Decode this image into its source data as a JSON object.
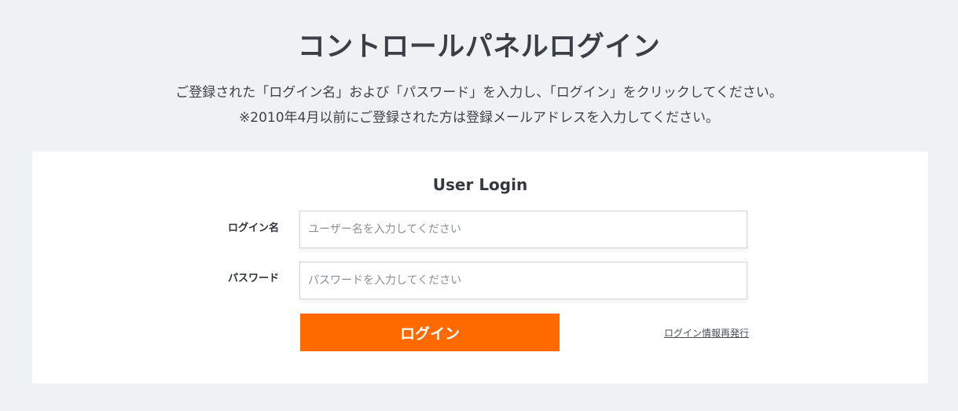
{
  "page": {
    "title": "コントロールパネルログイン",
    "description_line1": "ご登録された「ログイン名」および「パスワード」を入力し、「ログイン」をクリックしてください。",
    "description_line2": "※2010年4月以前にご登録された方は登録メールアドレスを入力してください。"
  },
  "login_panel": {
    "title": "User Login",
    "username": {
      "label": "ログイン名",
      "value": "",
      "placeholder": "ユーザー名を入力してください"
    },
    "password": {
      "label": "パスワード",
      "value": "",
      "placeholder": "パスワードを入力してください"
    },
    "login_button_label": "ログイン",
    "reissue_link_label": "ログイン情報再発行"
  },
  "colors": {
    "background": "#eff2f5",
    "panel": "#ffffff",
    "accent": "#ff6a00",
    "text": "#3a3f45"
  }
}
